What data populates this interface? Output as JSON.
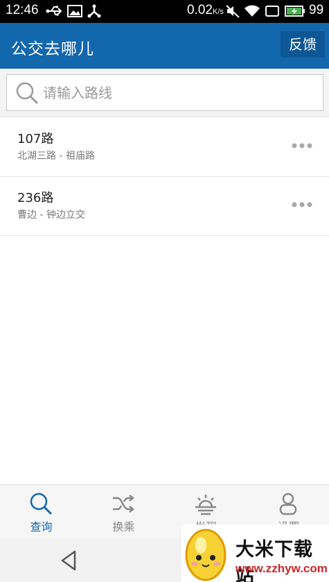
{
  "status_bar": {
    "time": "12:46",
    "speed_value": "0.02",
    "speed_unit": "K/s",
    "battery": "99",
    "icons": [
      "usb-icon",
      "image-icon",
      "share-icon",
      "mute-icon",
      "wifi-icon",
      "screen-icon",
      "battery-icon"
    ]
  },
  "app_bar": {
    "title": "公交去哪儿",
    "feedback_label": "反馈",
    "background": "#1367ad"
  },
  "search": {
    "placeholder": "请输入路线",
    "value": ""
  },
  "routes": [
    {
      "name": "107路",
      "desc": "北湖三路 - 祖庙路"
    },
    {
      "name": "236路",
      "desc": "曹边 - 钟边立交"
    }
  ],
  "tabs": [
    {
      "label": "查询",
      "icon": "search-icon",
      "active": true
    },
    {
      "label": "换乘",
      "icon": "shuffle-icon",
      "active": false
    },
    {
      "label": "发现",
      "icon": "sunrise-icon",
      "active": false
    },
    {
      "label": "设置",
      "icon": "user-icon",
      "active": false
    }
  ],
  "watermark": {
    "title": "大米下载站",
    "url": "www.zzhyw.com"
  },
  "accent_color": "#1367ad"
}
